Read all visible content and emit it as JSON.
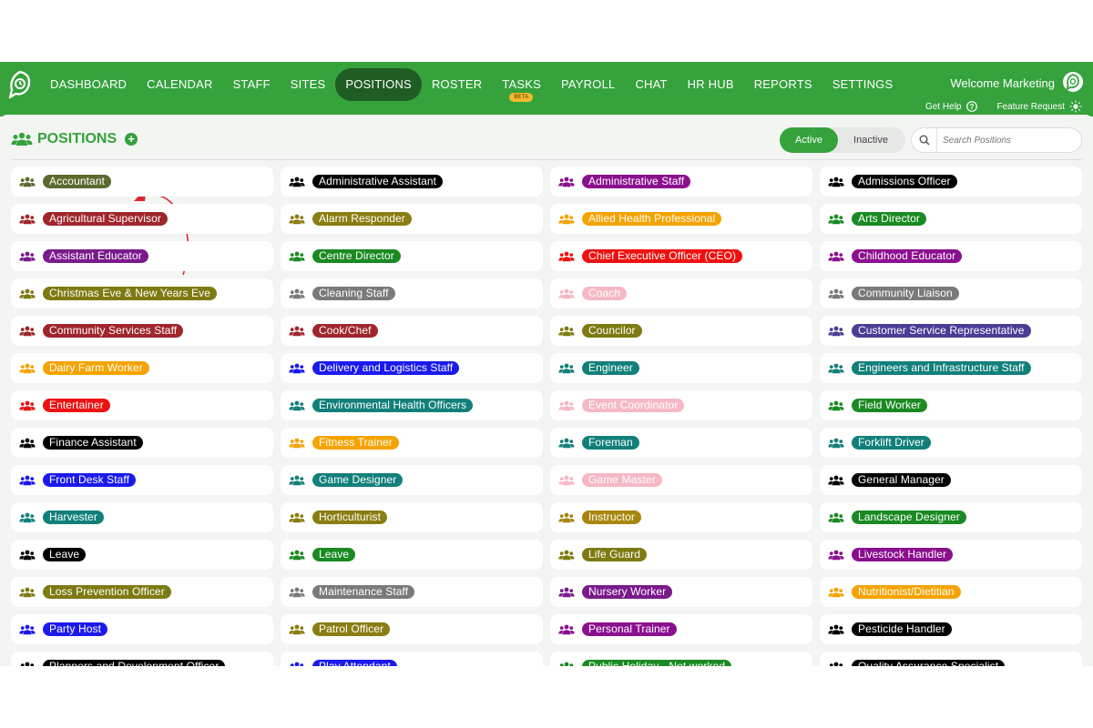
{
  "nav": {
    "items": [
      "DASHBOARD",
      "CALENDAR",
      "STAFF",
      "SITES",
      "POSITIONS",
      "ROSTER",
      "TASKS",
      "PAYROLL",
      "CHAT",
      "HR HUB",
      "REPORTS",
      "SETTINGS"
    ],
    "active": "POSITIONS",
    "tasks_badge": "BETA",
    "welcome": "Welcome Marketing",
    "get_help": "Get Help",
    "feature_request": "Feature Request",
    "brand_color": "#35a23c"
  },
  "page": {
    "title": "POSITIONS",
    "filter_active": "Active",
    "filter_inactive": "Inactive",
    "search_placeholder": "Search Positions",
    "add_icon": "plus-circle-icon"
  },
  "positions": [
    {
      "label": "Accountant",
      "color": "#5a6b2e"
    },
    {
      "label": "Administrative Assistant",
      "color": "#000000"
    },
    {
      "label": "Administrative Staff",
      "color": "#8b0f8f"
    },
    {
      "label": "Admissions Officer",
      "color": "#000000"
    },
    {
      "label": "Agricultural Supervisor",
      "color": "#a0262c"
    },
    {
      "label": "Alarm Responder",
      "color": "#8a7d12"
    },
    {
      "label": "Allied Health Professional",
      "color": "#f5a300"
    },
    {
      "label": "Arts Director",
      "color": "#1a8a22"
    },
    {
      "label": "Assistant Educator",
      "color": "#7a1a8c"
    },
    {
      "label": "Centre Director",
      "color": "#1a8a22"
    },
    {
      "label": "Chief Executive Officer (CEO)",
      "color": "#ee1111"
    },
    {
      "label": "Childhood Educator",
      "color": "#8b0f8f"
    },
    {
      "label": "Christmas Eve & New Years Eve",
      "color": "#7d7a12"
    },
    {
      "label": "Cleaning Staff",
      "color": "#7a7a7a"
    },
    {
      "label": "Coach",
      "color": "#f5b8c4"
    },
    {
      "label": "Community Liaison",
      "color": "#7a7a7a"
    },
    {
      "label": "Community Services Staff",
      "color": "#a0262c"
    },
    {
      "label": "Cook/Chef",
      "color": "#a0262c"
    },
    {
      "label": "Councilor",
      "color": "#7d7a12"
    },
    {
      "label": "Customer Service Representative",
      "color": "#4b3c96"
    },
    {
      "label": "Dairy Farm Worker",
      "color": "#f5a300"
    },
    {
      "label": "Delivery and Logistics Staff",
      "color": "#1a1aee"
    },
    {
      "label": "Engineer",
      "color": "#12807a"
    },
    {
      "label": "Engineers and Infrastructure Staff",
      "color": "#12807a"
    },
    {
      "label": "Entertainer",
      "color": "#ee1111"
    },
    {
      "label": "Environmental Health Officers",
      "color": "#12807a"
    },
    {
      "label": "Event Coordinator",
      "color": "#f5b8c4"
    },
    {
      "label": "Field Worker",
      "color": "#1a8a22"
    },
    {
      "label": "Finance Assistant",
      "color": "#000000"
    },
    {
      "label": "Fitness Trainer",
      "color": "#f5a300"
    },
    {
      "label": "Foreman",
      "color": "#12807a"
    },
    {
      "label": "Forklift Driver",
      "color": "#12807a"
    },
    {
      "label": "Front Desk Staff",
      "color": "#1a1aee"
    },
    {
      "label": "Game Designer",
      "color": "#12807a"
    },
    {
      "label": "Game Master",
      "color": "#f5b8c4"
    },
    {
      "label": "General Manager",
      "color": "#000000"
    },
    {
      "label": "Harvester",
      "color": "#12807a"
    },
    {
      "label": "Horticulturist",
      "color": "#8a7d12"
    },
    {
      "label": "Instructor",
      "color": "#a8860e"
    },
    {
      "label": "Landscape Designer",
      "color": "#1a8a22"
    },
    {
      "label": "Leave",
      "color": "#000000"
    },
    {
      "label": "Leave",
      "color": "#1a8a22"
    },
    {
      "label": "Life Guard",
      "color": "#7d7a12"
    },
    {
      "label": "Livestock Handler",
      "color": "#8b0f8f"
    },
    {
      "label": "Loss Prevention Officer",
      "color": "#7d7a12"
    },
    {
      "label": "Maintenance Staff",
      "color": "#7a7a7a"
    },
    {
      "label": "Nursery Worker",
      "color": "#7a1a8c"
    },
    {
      "label": "Nutritionist/Dietitian",
      "color": "#f5a300"
    },
    {
      "label": "Party Host",
      "color": "#1a1aee"
    },
    {
      "label": "Patrol Officer",
      "color": "#8a7d12"
    },
    {
      "label": "Personal Trainer",
      "color": "#8b0f8f"
    },
    {
      "label": "Pesticide Handler",
      "color": "#000000"
    },
    {
      "label": "Planners and Development Officer",
      "color": "#000000"
    },
    {
      "label": "Play Attendant",
      "color": "#1a1aee"
    },
    {
      "label": "Public Holiday - Not worked",
      "color": "#1a8a22"
    },
    {
      "label": "Quality Assurance Specialist",
      "color": "#000000"
    }
  ]
}
